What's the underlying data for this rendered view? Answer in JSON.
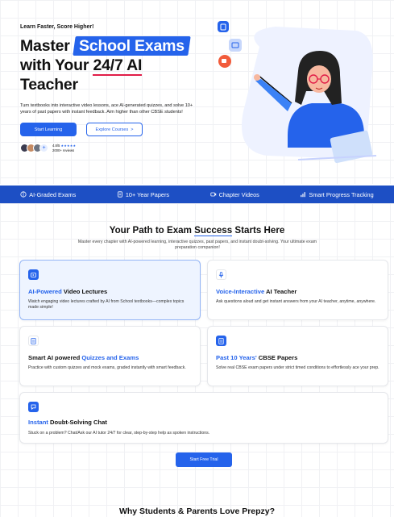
{
  "hero": {
    "tagline": "Learn Faster, Score Higher!",
    "title_part1": "Master ",
    "title_highlight": "School Exams",
    "title_part2": "with Your ",
    "title_underline": "24/7 AI",
    "title_part3": "Teacher",
    "description": "Turn textbooks into interactive video lessons, ace AI-generated quizzes, and solve 10+ years of past papers with instant feedback. Aim higher than other CBSE students!",
    "primary_button": "Start Learning",
    "secondary_button": "Explore Courses",
    "secondary_chevron": ">",
    "rating_value": "4.8/5",
    "rating_stars": "★★★★★",
    "reviews": "2000+ reviews",
    "avatar_plus": "+"
  },
  "feature_bar": {
    "items": [
      {
        "label": "AI-Graded Exams",
        "icon": "brain-icon"
      },
      {
        "label": "10+ Year Papers",
        "icon": "document-icon"
      },
      {
        "label": "Chapter Videos",
        "icon": "video-icon"
      },
      {
        "label": "Smart Progress Tracking",
        "icon": "bar-chart-icon"
      }
    ]
  },
  "path_section": {
    "title_before": "Your Path to Exam ",
    "title_underlined": "Success",
    "title_after": " Starts Here",
    "subtitle": "Master every chapter with AI-powered learning, interactive quizzes, past papers, and instant doubt-solving. Your ultimate exam preparation companion!",
    "cards": [
      {
        "title_blue": "AI-Powered",
        "title_rest": " Video Lectures",
        "desc": "Watch engaging video lectures crafted by AI from School textbooks—complex topics made simple!",
        "icon": "video-icon"
      },
      {
        "title_blue": "Voice-Interactive",
        "title_rest": " AI Teacher",
        "desc": "Ask questions aloud and get instant answers from your AI teacher, anytime, anywhere.",
        "icon": "microphone-icon"
      },
      {
        "title_rest": "Smart AI powered ",
        "title_blue": "Quizzes and Exams",
        "desc": "Practice with custom quizzes and mock exams, graded instantly with smart feedback.",
        "icon": "quiz-icon"
      },
      {
        "title_blue": "Past 10 Years'",
        "title_rest": " CBSE Papers",
        "desc": "Solve real CBSE exam papers under strict timed conditions to effortlessly ace your prep.",
        "icon": "paper-icon"
      },
      {
        "title_blue": "Instant",
        "title_rest": " Doubt-Solving Chat",
        "desc": "Stuck on a problem? Chat/Ask our AI tutor 24/7 for clear, step-by-step help as spoken instructions.",
        "icon": "chat-icon"
      }
    ],
    "cta": "Start Free Trial"
  },
  "why_section": {
    "title": "Why Students & Parents Love Prepzy?"
  },
  "colors": {
    "brand_blue": "#2563eb",
    "bar_blue": "#1d4fc4",
    "accent_red": "#e11d48"
  }
}
